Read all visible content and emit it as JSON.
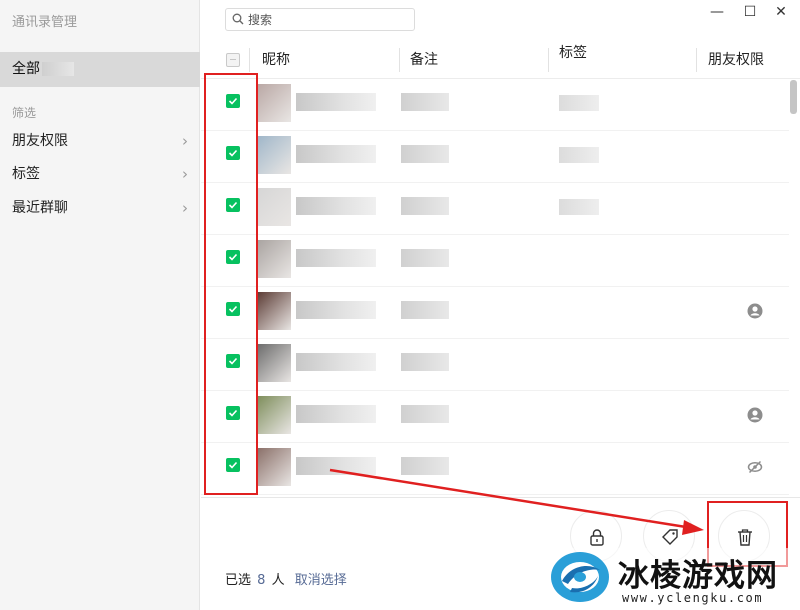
{
  "app": {
    "title": "通讯录管理"
  },
  "window": {
    "minimize_glyph": "—",
    "maximize_glyph": "☐",
    "close_glyph": "✕"
  },
  "sidebar": {
    "all_label": "全部",
    "filter_section": "筛选",
    "items": [
      {
        "label": "朋友权限",
        "chevron": "›"
      },
      {
        "label": "标签",
        "chevron": "›"
      },
      {
        "label": "最近群聊",
        "chevron": "›"
      }
    ]
  },
  "search": {
    "placeholder": "搜索",
    "value": ""
  },
  "table": {
    "columns": {
      "nickname": "昵称",
      "remark": "备注",
      "tags": "标签",
      "permission": "朋友权限"
    },
    "rows": [
      {
        "checked": true,
        "avatar_color": "#b9a7a4",
        "permission_icon": ""
      },
      {
        "checked": true,
        "avatar_color": "#9fb6c9",
        "permission_icon": ""
      },
      {
        "checked": true,
        "avatar_color": "#d6d6d6",
        "permission_icon": ""
      },
      {
        "checked": true,
        "avatar_color": "#a9a3a0",
        "permission_icon": ""
      },
      {
        "checked": true,
        "avatar_color": "#5b3a33",
        "permission_icon": "contact-icon"
      },
      {
        "checked": true,
        "avatar_color": "#6b6b6b",
        "permission_icon": ""
      },
      {
        "checked": true,
        "avatar_color": "#7d8d5a",
        "permission_icon": "contact-icon"
      },
      {
        "checked": true,
        "avatar_color": "#8a6f68",
        "permission_icon": "eye-off-icon"
      }
    ]
  },
  "footer": {
    "selected_prefix": "已选",
    "selected_count": "8",
    "selected_unit": "人",
    "cancel_label": "取消选择"
  },
  "actions": {
    "permission_icon": "lock-icon",
    "tag_icon": "tag-icon",
    "delete_icon": "trash-icon"
  },
  "colors": {
    "accent_green": "#07c160",
    "link_blue": "#576b95",
    "annotation_red": "#e02020"
  },
  "watermark": {
    "title": "冰棱游戏网",
    "url": "www.yclengku.com"
  }
}
